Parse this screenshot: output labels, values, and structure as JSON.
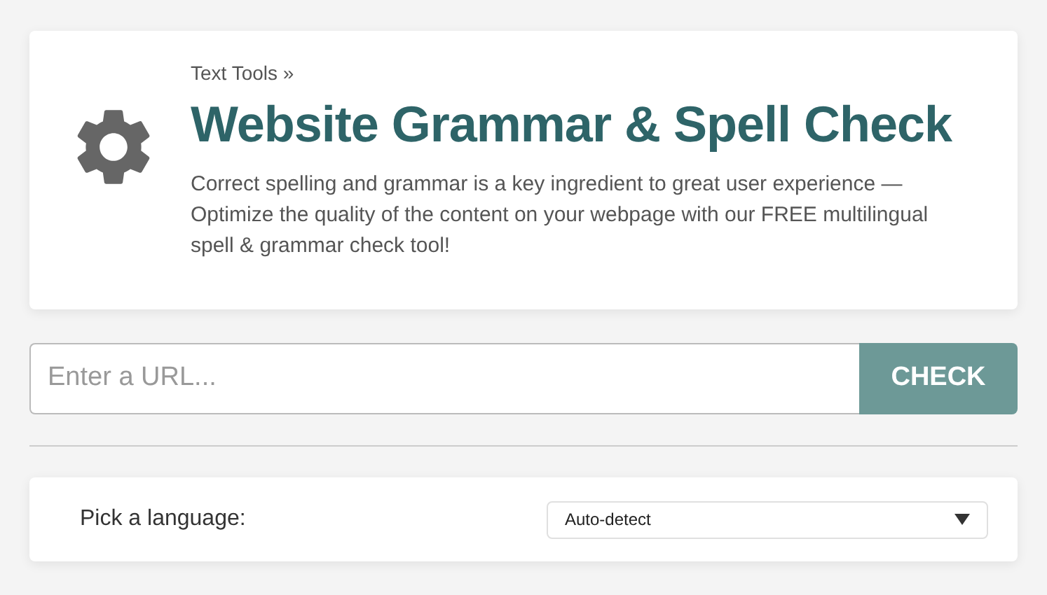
{
  "header": {
    "breadcrumb": "Text Tools »",
    "title": "Website Grammar & Spell Check",
    "description": "Correct spelling and grammar is a key ingredient to great user experience — Optimize the quality of the content on your webpage with our FREE multilingual spell & grammar check tool!"
  },
  "url_form": {
    "placeholder": "Enter a URL...",
    "button": "CHECK"
  },
  "language": {
    "label": "Pick a language:",
    "value": "Auto-detect"
  }
}
